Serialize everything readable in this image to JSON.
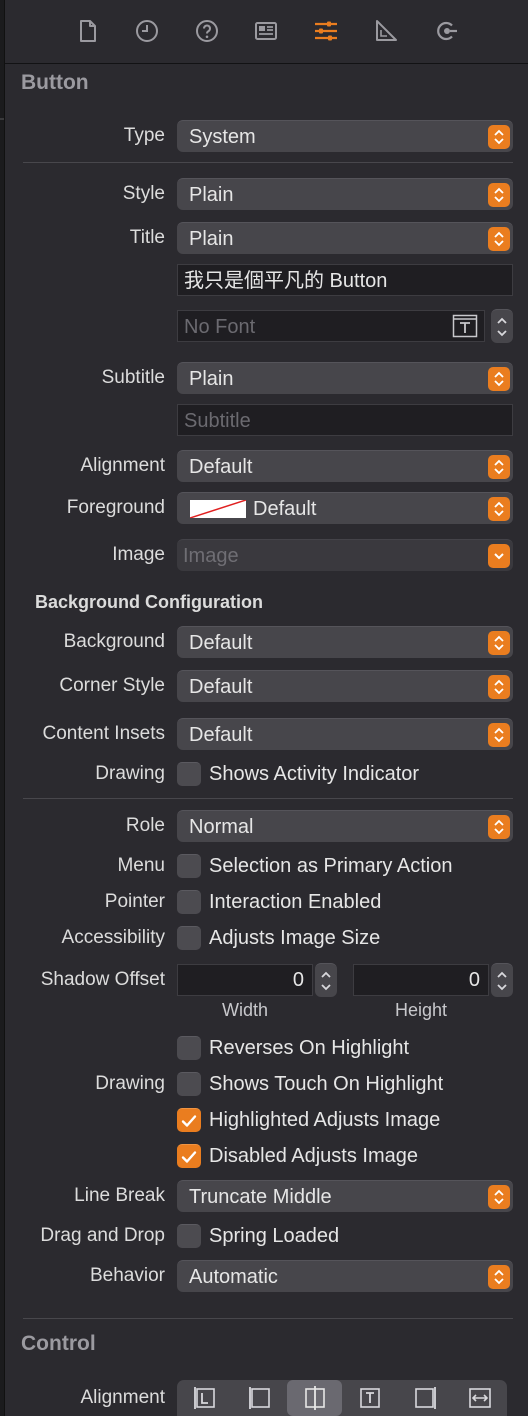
{
  "colors": {
    "accent": "#ea7d1f",
    "panel": "#2b2a2f"
  },
  "toolbar": {
    "icons": [
      "file-icon",
      "history-icon",
      "help-icon",
      "identity-inspector-icon",
      "attributes-inspector-icon",
      "size-inspector-icon",
      "connections-inspector-icon"
    ],
    "selected": "attributes-inspector-icon"
  },
  "button_section": {
    "title": "Button",
    "type_label": "Type",
    "type_value": "System",
    "style_label": "Style",
    "style_value": "Plain",
    "title_label": "Title",
    "title_value": "Plain",
    "title_text": "我只是個平凡的 Button",
    "font_placeholder": "No Font",
    "subtitle_label": "Subtitle",
    "subtitle_value": "Plain",
    "subtitle_placeholder": "Subtitle",
    "alignment_label": "Alignment",
    "alignment_value": "Default",
    "foreground_label": "Foreground",
    "foreground_value": "Default",
    "image_label": "Image",
    "image_placeholder": "Image"
  },
  "background_config": {
    "title": "Background Configuration",
    "background_label": "Background",
    "background_value": "Default",
    "corner_label": "Corner Style",
    "corner_value": "Default",
    "insets_label": "Content Insets",
    "insets_value": "Default",
    "drawing_label": "Drawing",
    "activity_indicator": "Shows Activity Indicator"
  },
  "behaviors": {
    "role_label": "Role",
    "role_value": "Normal",
    "menu_label": "Menu",
    "menu_option": "Selection as Primary Action",
    "pointer_label": "Pointer",
    "pointer_option": "Interaction Enabled",
    "accessibility_label": "Accessibility",
    "accessibility_option": "Adjusts Image Size",
    "shadow_label": "Shadow Offset",
    "shadow_width": "0",
    "shadow_height": "0",
    "width_caption": "Width",
    "height_caption": "Height",
    "reverses": "Reverses On Highlight",
    "drawing_label": "Drawing",
    "shows_touch": "Shows Touch On Highlight",
    "highlighted_adjusts": "Highlighted Adjusts Image",
    "disabled_adjusts": "Disabled Adjusts Image",
    "linebreak_label": "Line Break",
    "linebreak_value": "Truncate Middle",
    "dragdrop_label": "Drag and Drop",
    "spring_loaded": "Spring Loaded",
    "behavior_label": "Behavior",
    "behavior_value": "Automatic"
  },
  "control_section": {
    "title": "Control",
    "alignment_label": "Alignment",
    "alignment_icons": [
      "align-leading-icon",
      "align-left-edge-icon",
      "align-center-icon",
      "align-top-icon",
      "align-right-edge-icon",
      "align-fill-icon"
    ],
    "selected_alignment": "align-center-icon"
  }
}
